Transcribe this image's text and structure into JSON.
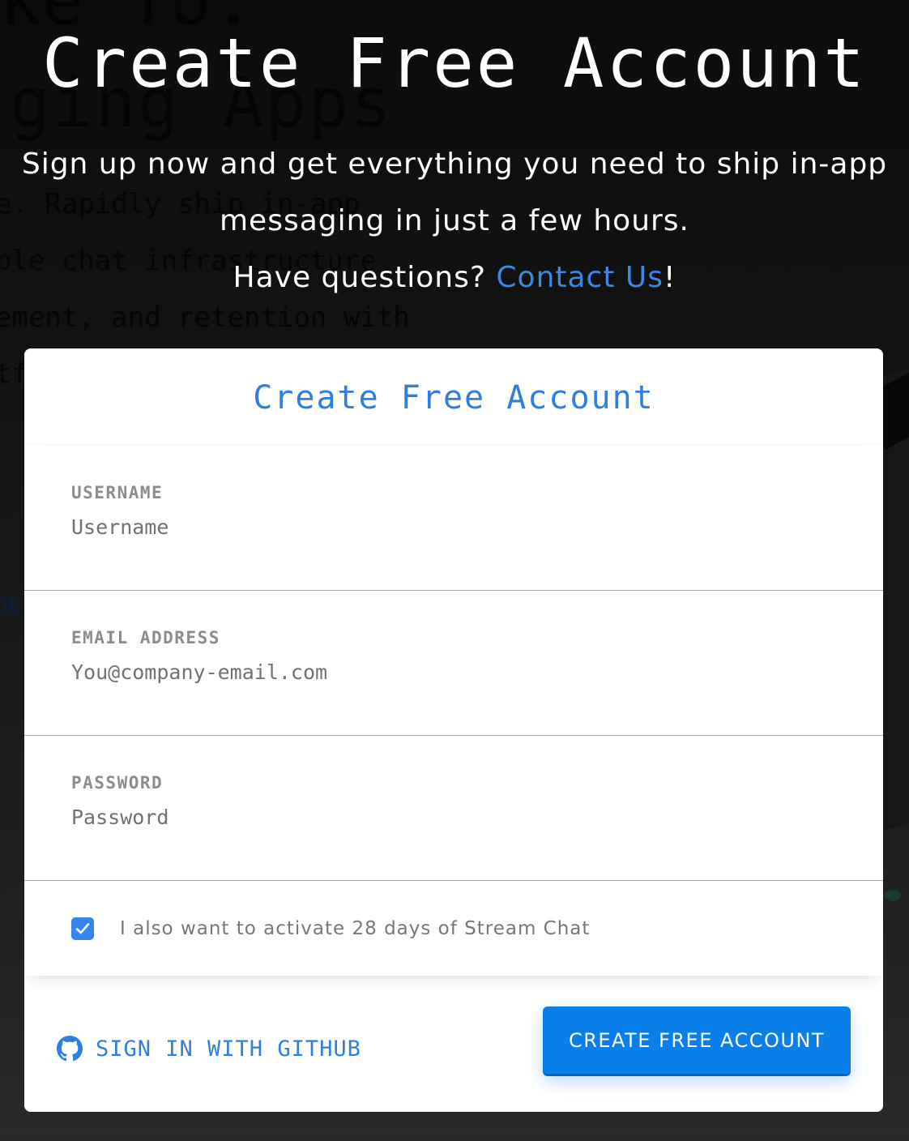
{
  "background_page": {
    "heading_fragment_top": "ke To:",
    "heading_fragment": "ging Apps",
    "body_lines": [
      "e. Rapidly ship in-app",
      "ble chat infrastructure",
      "ement, and retention with",
      "tf"
    ],
    "link_fragment": "DE"
  },
  "hero": {
    "title": "Create Free Account",
    "subtitle": "Sign up now and get everything you need to ship in-app messaging in just a few hours.",
    "question": "Have questions? ",
    "contact_link": "Contact Us",
    "question_suffix": "!"
  },
  "form": {
    "title": "Create Free Account",
    "fields": [
      {
        "label": "USERNAME",
        "placeholder": "Username",
        "value": "",
        "type": "text"
      },
      {
        "label": "EMAIL ADDRESS",
        "placeholder": "You@company-email.com",
        "value": "",
        "type": "email"
      },
      {
        "label": "PASSWORD",
        "placeholder": "Password",
        "value": "",
        "type": "password"
      }
    ],
    "trial_checkbox": {
      "checked": true,
      "label": "I also want to activate 28 days of Stream Chat"
    },
    "github_label": "SIGN IN WITH GITHUB",
    "submit_label": "CREATE FREE ACCOUNT"
  },
  "colors": {
    "accent": "#2f7ee2",
    "button": "#0a7fe9",
    "checkbox": "#3584f0",
    "overlay": "#111111"
  },
  "icons": {
    "github": "github-icon",
    "checkmark": "checkmark-icon"
  }
}
